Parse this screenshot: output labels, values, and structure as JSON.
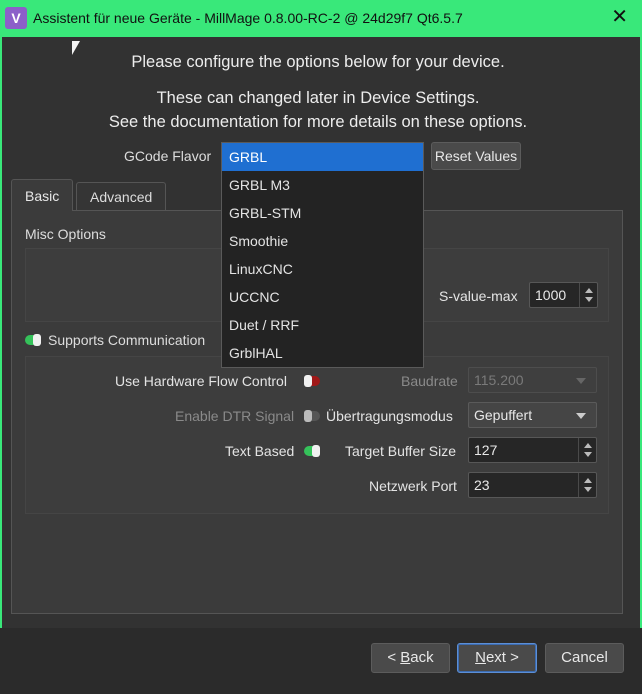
{
  "window": {
    "title": "Assistent für neue Geräte - MillMage 0.8.00-RC-2 @ 24d29f7 Qt6.5.7",
    "app_icon_glyph": "V",
    "close_glyph": "✕",
    "accent_color": "#39e87a"
  },
  "intro": {
    "line1": "Please configure the options below for your device.",
    "line2": "These can changed later in Device Settings.",
    "line3": "See the documentation for more details on these options."
  },
  "gcode_flavor": {
    "label": "GCode Flavor",
    "selected": "GRBL",
    "options": [
      "GRBL",
      "GRBL M3",
      "GRBL-STM",
      "Smoothie",
      "LinuxCNC",
      "UCCNC",
      "Duet / RRF",
      "GrblHAL"
    ],
    "reset_label": "Reset Values"
  },
  "tabs": [
    {
      "label": "Basic",
      "active": true
    },
    {
      "label": "Advanced",
      "active": false
    }
  ],
  "misc": {
    "title": "Misc Options",
    "s_value_max_label": "S-value-max",
    "s_value_max": "1000"
  },
  "communication": {
    "title": "Supports Communication",
    "enabled": true,
    "hw_flow_label": "Use Hardware Flow Control",
    "hw_flow_on": false,
    "dtr_label": "Enable DTR Signal",
    "dtr_on": false,
    "text_based_label": "Text Based",
    "text_based_on": true,
    "baud_label": "Baudrate",
    "baud_value": "115.200",
    "transfer_label": "Übertragungsmodus",
    "transfer_value": "Gepuffert",
    "buffer_label": "Target Buffer Size",
    "buffer_value": "127",
    "port_label": "Netzwerk Port",
    "port_value": "23"
  },
  "buttons": {
    "back_prefix": "< ",
    "back_key": "B",
    "back_rest": "ack",
    "next_key": "N",
    "next_rest": "ext >",
    "cancel": "Cancel"
  }
}
